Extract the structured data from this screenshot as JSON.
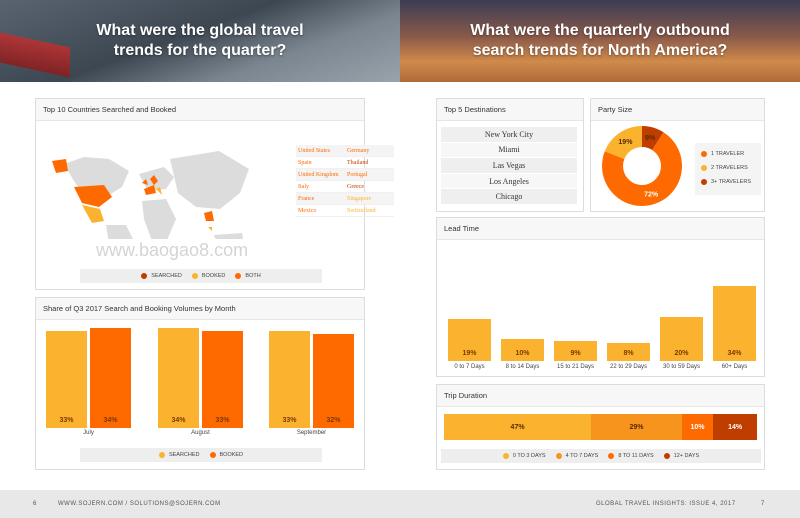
{
  "colors": {
    "light": "#fbb32f",
    "mid": "#f7941e",
    "dark": "#ff6a00",
    "darkest": "#c03d00"
  },
  "hero": {
    "left_title": "What were the global travel trends for the quarter?",
    "right_title": "What were the quarterly outbound search trends for North America?"
  },
  "top_countries": {
    "title": "Top 10 Countries Searched and Booked",
    "rows": [
      [
        "United States",
        "Germany"
      ],
      [
        "Spain",
        "Thailand"
      ],
      [
        "United Kingdom",
        "Portugal"
      ],
      [
        "Italy",
        "Greece"
      ],
      [
        "France",
        "Singapore"
      ],
      [
        "Mexico",
        "Switzerland"
      ]
    ],
    "legend": [
      "SEARCHED",
      "BOOKED",
      "BOTH"
    ]
  },
  "watermark": "www.baogao8.com",
  "share_chart": {
    "title": "Share of Q3 2017 Search and Booking Volumes by Month",
    "legend": [
      "SEARCHED",
      "BOOKED"
    ]
  },
  "top_destinations": {
    "title": "Top 5 Destinations",
    "items": [
      "New York City",
      "Miami",
      "Las Vegas",
      "Los Angeles",
      "Chicago"
    ]
  },
  "party_size": {
    "title": "Party Size",
    "legend": [
      "1 TRAVELER",
      "2 TRAVELERS",
      "3+ TRAVELERS"
    ]
  },
  "lead_time": {
    "title": "Lead Time"
  },
  "trip_duration": {
    "title": "Trip Duration",
    "legend": [
      "0 TO 3 DAYS",
      "4 TO 7 DAYS",
      "8 TO 11 DAYS",
      "12+ DAYS"
    ]
  },
  "footer": {
    "left_page": "6",
    "links": "WWW.SOJERN.COM  /  SOLUTIONS@SOJERN.COM",
    "right_title": "GLOBAL TRAVEL INSIGHTS: ISSUE 4, 2017",
    "right_page": "7"
  },
  "chart_data": [
    {
      "type": "bar",
      "title": "Share of Q3 2017 Search and Booking Volumes by Month",
      "categories": [
        "July",
        "August",
        "September"
      ],
      "series": [
        {
          "name": "SEARCHED",
          "values": [
            33,
            34,
            33
          ]
        },
        {
          "name": "BOOKED",
          "values": [
            34,
            33,
            32
          ]
        }
      ],
      "value_labels": [
        [
          "33%",
          "34%"
        ],
        [
          "34%",
          "33%"
        ],
        [
          "33%",
          "32%"
        ]
      ],
      "legend": "bottom"
    },
    {
      "type": "pie",
      "title": "Party Size",
      "categories": [
        "1 TRAVELER",
        "2 TRAVELERS",
        "3+ TRAVELERS"
      ],
      "values": [
        72,
        19,
        9
      ],
      "value_labels": [
        "72%",
        "19%",
        "9%"
      ],
      "legend": "right"
    },
    {
      "type": "bar",
      "title": "Lead Time",
      "categories": [
        "0 to 7 Days",
        "8 to 14 Days",
        "15 to 21 Days",
        "22 to 29 Days",
        "30 to 59 Days",
        "60+ Days"
      ],
      "values": [
        19,
        10,
        9,
        8,
        20,
        34
      ],
      "value_labels": [
        "19%",
        "10%",
        "9%",
        "8%",
        "20%",
        "34%"
      ]
    },
    {
      "type": "bar",
      "title": "Trip Duration",
      "categories": [
        "0 TO 3 DAYS",
        "4 TO 7 DAYS",
        "8 TO 11 DAYS",
        "12+ DAYS"
      ],
      "values": [
        47,
        29,
        10,
        14
      ],
      "value_labels": [
        "47%",
        "29%",
        "10%",
        "14%"
      ],
      "stacked": true,
      "legend": "bottom"
    }
  ]
}
